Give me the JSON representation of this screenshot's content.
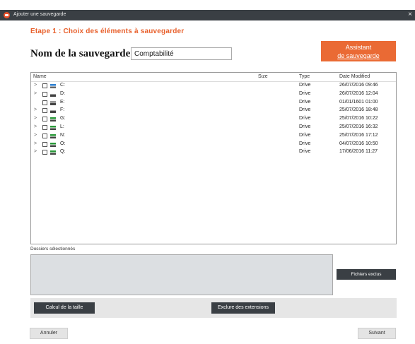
{
  "window": {
    "title": "Ajouter une sauvegarde",
    "close_glyph": "×"
  },
  "step": {
    "text": "Etape 1 :   Choix des éléments à sauvegarder"
  },
  "backup_name": {
    "label": "Nom de la sauvegarde :",
    "value": "Comptabilité"
  },
  "assistant_button": {
    "line1": "Assistant",
    "line2": "de sauvegarde"
  },
  "tree": {
    "headers": {
      "name": "Name",
      "size": "Size",
      "type": "Type",
      "date": "Date Modified"
    },
    "expander_glyph": ">",
    "rows": [
      {
        "name": "C:",
        "type": "Drive",
        "date": "26/07/2016 09:46",
        "icon": "system-drive-icon",
        "expandable": true
      },
      {
        "name": "D:",
        "type": "Drive",
        "date": "26/07/2016 12:04",
        "icon": "local-drive-icon",
        "expandable": true
      },
      {
        "name": "E:",
        "type": "Drive",
        "date": "01/01/1601 01:00",
        "icon": "optical-drive-icon",
        "expandable": false
      },
      {
        "name": "F:",
        "type": "Drive",
        "date": "25/07/2016 18:48",
        "icon": "local-drive-icon",
        "expandable": true
      },
      {
        "name": "G:",
        "type": "Drive",
        "date": "25/07/2016 10:22",
        "icon": "network-drive-icon",
        "expandable": true
      },
      {
        "name": "L:",
        "type": "Drive",
        "date": "25/07/2016 16:32",
        "icon": "network-drive-icon",
        "expandable": true
      },
      {
        "name": "N:",
        "type": "Drive",
        "date": "25/07/2016 17:12",
        "icon": "network-drive-icon",
        "expandable": true
      },
      {
        "name": "O:",
        "type": "Drive",
        "date": "04/07/2016 10:50",
        "icon": "network-drive-icon",
        "expandable": true
      },
      {
        "name": "Q:",
        "type": "Drive",
        "date": "17/06/2016 11:27",
        "icon": "network-drive-icon",
        "expandable": true
      }
    ]
  },
  "selected_folders": {
    "label": "Dossiers sélectionnés"
  },
  "buttons": {
    "excluded_files": "Fichiers exclus",
    "calc_size": "Calcul de la taille",
    "exclude_extensions": "Exclure des extensions",
    "cancel": "Annuler",
    "next": "Suivant"
  },
  "colors": {
    "accent": "#ea6a34",
    "titlebar": "#3a3f44",
    "step_text": "#e8602c"
  }
}
